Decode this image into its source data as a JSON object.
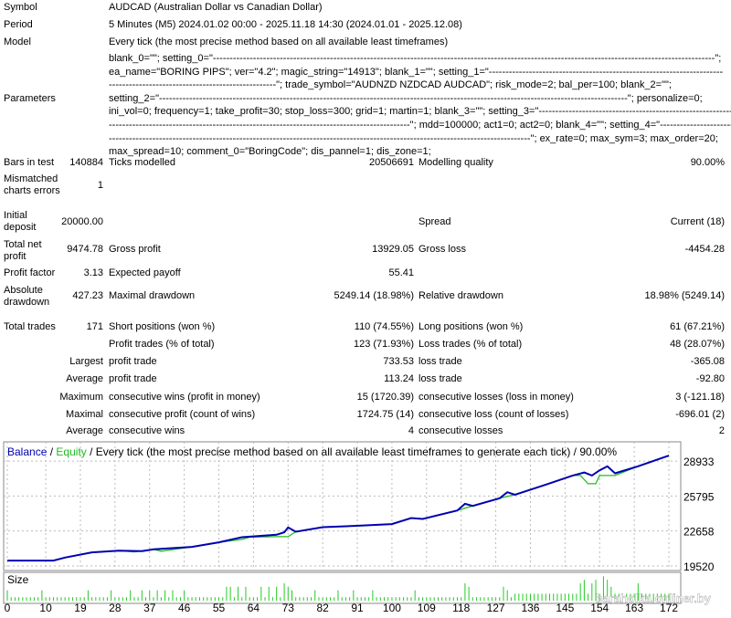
{
  "info": {
    "symbol_label": "Symbol",
    "symbol": "AUDCAD (Australian Dollar vs Canadian Dollar)",
    "period_label": "Period",
    "period": "5 Minutes (M5) 2024.01.02 00:00 - 2025.11.18 14:30 (2024.01.01 - 2025.12.08)",
    "model_label": "Model",
    "model": "Every tick (the most precise method based on all available least timeframes)",
    "parameters_label": "Parameters",
    "parameters_lines": [
      "blank_0=\"\"; setting_0=\"------------------------------------------------------------------------------------------------------------------------------------------------------\";",
      "ea_name=\"BORING PIPS\"; ver=\"4.2\"; magic_string=\"14913\"; blank_1=\"\"; setting_1=\"----------------------------------------------------------------------",
      "--------------------------------------------------\"; trade_symbol=\"AUDNZD NZDCAD AUDCAD\"; risk_mode=2; bal_per=100; blank_2=\"\";",
      "setting_2=\"--------------------------------------------------------------------------------------------------------------------------------------------\"; personalize=0;",
      "ini_vol=0; frequency=1; take_profit=30; stop_loss=300; grid=1; martin=1; blank_3=\"\"; setting_3=\"--------------------------------------------------------------------------------",
      "------------------------------------------------------------------------------------------\"; mdd=100000; act1=0; act2=0; blank_4=\"\"; setting_4=\"----------------------------------------",
      "------------------------------------------------------------------------------------------------------------------------------\"; ex_rate=0; max_sym=3; max_order=20;",
      "max_spread=10; comment_0=\"BoringCode\"; dis_pannel=1; dis_zone=1;"
    ]
  },
  "stats": {
    "bars_label": "Bars in test",
    "bars": "140884",
    "ticks_label": "Ticks modelled",
    "ticks": "20506691",
    "quality_label": "Modelling quality",
    "quality": "90.00%",
    "mismatch_label_1": "Mismatched",
    "mismatch_label_2": "charts errors",
    "mismatch": "1",
    "deposit_label_1": "Initial",
    "deposit_label_2": "deposit",
    "deposit": "20000.00",
    "spread_label": "Spread",
    "spread": "Current (18)",
    "net_label_1": "Total net",
    "net_label_2": "profit",
    "net": "9474.78",
    "gross_profit_label": "Gross profit",
    "gross_profit": "13929.05",
    "gross_loss_label": "Gross loss",
    "gross_loss": "-4454.28",
    "pf_label": "Profit factor",
    "pf": "3.13",
    "payoff_label": "Expected payoff",
    "payoff": "55.41",
    "abs_dd_label_1": "Absolute",
    "abs_dd_label_2": "drawdown",
    "abs_dd": "427.23",
    "max_dd_label": "Maximal drawdown",
    "max_dd": "5249.14 (18.98%)",
    "rel_dd_label": "Relative drawdown",
    "rel_dd": "18.98% (5249.14)",
    "trades_label": "Total trades",
    "trades": "171",
    "short_label": "Short positions (won %)",
    "short": "110 (74.55%)",
    "long_label": "Long positions (won %)",
    "long": "61 (67.21%)",
    "profit_trades_label": "Profit trades (% of total)",
    "profit_trades": "123 (71.93%)",
    "loss_trades_label": "Loss trades (% of total)",
    "loss_trades": "48 (28.07%)",
    "largest_label": "Largest",
    "largest_profit_label": "profit trade",
    "largest_profit": "733.53",
    "largest_loss_label": "loss trade",
    "largest_loss": "-365.08",
    "average_label": "Average",
    "avg_profit_label": "profit trade",
    "avg_profit": "113.24",
    "avg_loss_label": "loss trade",
    "avg_loss": "-92.80",
    "maximum_label": "Maximum",
    "max_wins_label": "consecutive wins (profit in money)",
    "max_wins": "15 (1720.39)",
    "max_losses_label": "consecutive losses (loss in money)",
    "max_losses": "3 (-121.18)",
    "maximal_label": "Maximal",
    "maximal_profit_label": "consecutive profit (count of wins)",
    "maximal_profit": "1724.75 (14)",
    "maximal_loss_label": "consecutive loss (count of losses)",
    "maximal_loss": "-696.01 (2)",
    "average2_label": "Average",
    "avg_wins_label": "consecutive wins",
    "avg_wins": "4",
    "avg_losses_label": "consecutive losses",
    "avg_losses": "2"
  },
  "chart_data": {
    "type": "line",
    "title_balance": "Balance",
    "title_sep1": " / ",
    "title_equity": "Equity",
    "title_rest": " / Every tick (the most precise method based on all available least timeframes to generate each tick) / 90.00%",
    "colors": {
      "balance": "#0000b0",
      "equity": "#22bb22",
      "size": "#22cc22"
    },
    "yticks": [
      19520,
      22658,
      25795,
      28933
    ],
    "ylim": [
      19520,
      29500
    ],
    "xticks": [
      0,
      10,
      19,
      28,
      37,
      46,
      55,
      64,
      73,
      82,
      91,
      100,
      109,
      118,
      127,
      136,
      145,
      154,
      163,
      172
    ],
    "xlim": [
      0,
      172
    ],
    "balance": [
      [
        0,
        20000
      ],
      [
        12,
        20000
      ],
      [
        15,
        20273
      ],
      [
        22,
        20737
      ],
      [
        29,
        20900
      ],
      [
        35,
        20850
      ],
      [
        38,
        21010
      ],
      [
        48,
        21230
      ],
      [
        55,
        21640
      ],
      [
        61,
        22100
      ],
      [
        70,
        22320
      ],
      [
        72,
        22540
      ],
      [
        73,
        22980
      ],
      [
        75,
        22590
      ],
      [
        82,
        23000
      ],
      [
        92,
        23140
      ],
      [
        100,
        23280
      ],
      [
        105,
        23820
      ],
      [
        108,
        23740
      ],
      [
        117,
        24500
      ],
      [
        119,
        25100
      ],
      [
        121,
        24910
      ],
      [
        128,
        25600
      ],
      [
        130,
        26140
      ],
      [
        132,
        25920
      ],
      [
        140,
        26820
      ],
      [
        147,
        27640
      ],
      [
        150,
        27910
      ],
      [
        152,
        27640
      ],
      [
        154,
        28100
      ],
      [
        156,
        28460
      ],
      [
        158,
        27830
      ],
      [
        164,
        28460
      ],
      [
        172,
        29420
      ]
    ],
    "equity": [
      [
        0,
        20000
      ],
      [
        12,
        20000
      ],
      [
        15,
        20273
      ],
      [
        22,
        20737
      ],
      [
        29,
        20900
      ],
      [
        33,
        20780
      ],
      [
        38,
        21010
      ],
      [
        40,
        20850
      ],
      [
        48,
        21230
      ],
      [
        55,
        21640
      ],
      [
        61,
        21900
      ],
      [
        63,
        22100
      ],
      [
        70,
        22150
      ],
      [
        73,
        22150
      ],
      [
        75,
        22590
      ],
      [
        82,
        23000
      ],
      [
        92,
        23140
      ],
      [
        100,
        23280
      ],
      [
        105,
        23820
      ],
      [
        108,
        23740
      ],
      [
        117,
        24500
      ],
      [
        121,
        24910
      ],
      [
        128,
        25600
      ],
      [
        132,
        25920
      ],
      [
        140,
        26820
      ],
      [
        147,
        27640
      ],
      [
        149,
        27640
      ],
      [
        151,
        26900
      ],
      [
        153,
        26900
      ],
      [
        154,
        27640
      ],
      [
        158,
        27640
      ],
      [
        164,
        28460
      ],
      [
        172,
        29420
      ]
    ],
    "size_label": "Size",
    "sizes": [
      0.03,
      0.01,
      0.01,
      0.01,
      0.01,
      0.01,
      0.01,
      0.01,
      0.01,
      0.03,
      0.01,
      0.01,
      0.01,
      0.01,
      0.01,
      0.01,
      0.01,
      0.01,
      0.01,
      0.01,
      0.01,
      0.03,
      0.01,
      0.01,
      0.01,
      0.01,
      0.01,
      0.03,
      0.01,
      0.01,
      0.01,
      0.01,
      0.03,
      0.01,
      0.01,
      0.03,
      0.01,
      0.03,
      0.01,
      0.03,
      0.01,
      0.03,
      0.01,
      0.03,
      0.01,
      0.01,
      0.03,
      0.01,
      0.01,
      0.01,
      0.01,
      0.01,
      0.01,
      0.01,
      0.01,
      0.01,
      0.01,
      0.04,
      0.04,
      0.01,
      0.04,
      0.01,
      0.04,
      0.01,
      0.01,
      0.01,
      0.04,
      0.01,
      0.04,
      0.01,
      0.04,
      0.01,
      0.05,
      0.04,
      0.03,
      0.01,
      0.01,
      0.01,
      0.01,
      0.01,
      0.03,
      0.01,
      0.01,
      0.01,
      0.01,
      0.01,
      0.03,
      0.01,
      0.01,
      0.01,
      0.03,
      0.01,
      0.01,
      0.01,
      0.01,
      0.03,
      0.01,
      0.01,
      0.01,
      0.01,
      0.01,
      0.01,
      0.01,
      0.01,
      0.01,
      0.01,
      0.03,
      0.01,
      0.01,
      0.01,
      0.01,
      0.01,
      0.01,
      0.01,
      0.01,
      0.01,
      0.01,
      0.01,
      0.01,
      0.05,
      0.04,
      0.01,
      0.01,
      0.01,
      0.01,
      0.01,
      0.01,
      0.01,
      0.01,
      0.04,
      0.03,
      0.01,
      0.02,
      0.02,
      0.02,
      0.02,
      0.02,
      0.02,
      0.02,
      0.02,
      0.02,
      0.02,
      0.02,
      0.02,
      0.02,
      0.02,
      0.02,
      0.02,
      0.02,
      0.05,
      0.06,
      0.02,
      0.05,
      0.06,
      0.02,
      0.07,
      0.06,
      0.04,
      0.02,
      0.02,
      0.02,
      0.02,
      0.02,
      0.02,
      0.05,
      0.02,
      0.02,
      0.02,
      0.02,
      0.02,
      0.02,
      0.02,
      0.02
    ],
    "watermark": "baraholka.onliner.by"
  }
}
